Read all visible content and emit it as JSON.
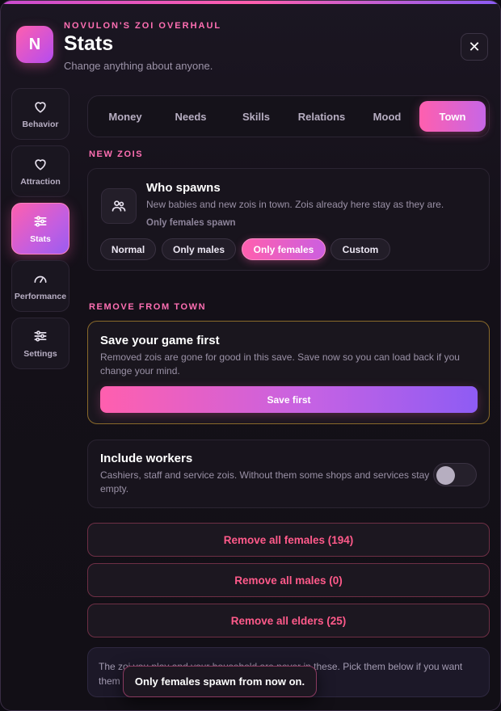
{
  "header": {
    "logo_letter": "N",
    "kicker": "NOVULON'S ZOI OVERHAUL",
    "title": "Stats",
    "subtitle": "Change anything about anyone.",
    "close_glyph": "✕"
  },
  "sidebar": {
    "items": [
      {
        "label": "Behavior",
        "icon": "heart-outline-icon",
        "active": false
      },
      {
        "label": "Attraction",
        "icon": "heart-icon",
        "active": false
      },
      {
        "label": "Stats",
        "icon": "sliders-icon",
        "active": true
      },
      {
        "label": "Performance",
        "icon": "gauge-icon",
        "active": false
      },
      {
        "label": "Settings",
        "icon": "sliders-icon",
        "active": false
      }
    ]
  },
  "tabs": [
    {
      "label": "Money",
      "active": false
    },
    {
      "label": "Needs",
      "active": false
    },
    {
      "label": "Skills",
      "active": false
    },
    {
      "label": "Relations",
      "active": false
    },
    {
      "label": "Mood",
      "active": false
    },
    {
      "label": "Town",
      "active": true
    }
  ],
  "new_zois": {
    "section_label": "NEW ZOIS",
    "title": "Who spawns",
    "description": "New babies and new zois in town. Zois already here stay as they are.",
    "status": "Only females spawn",
    "icon": "people-icon",
    "options": [
      {
        "label": "Normal",
        "active": false
      },
      {
        "label": "Only males",
        "active": false
      },
      {
        "label": "Only females",
        "active": true
      },
      {
        "label": "Custom",
        "active": false
      }
    ]
  },
  "remove_from_town": {
    "section_label": "REMOVE FROM TOWN",
    "warning": {
      "title": "Save your game first",
      "description": "Removed zois are gone for good in this save. Save now so you can load back if you change your mind.",
      "button_label": "Save first"
    },
    "include_workers": {
      "title": "Include workers",
      "description": "Cashiers, staff and service zois. Without them some shops and services stay empty.",
      "enabled": false
    },
    "actions": [
      {
        "label": "Remove all females (194)"
      },
      {
        "label": "Remove all males (0)"
      },
      {
        "label": "Remove all elders (25)"
      }
    ],
    "note": "The zoi you play and your household are never in these. Pick them below if you want them"
  },
  "toast": {
    "message": "Only females spawn from now on."
  },
  "colors": {
    "accent_pink": "#ff5fae",
    "accent_purple": "#8e5cf4",
    "danger": "#ff5a8a",
    "warning_border": "#8a6a2b"
  }
}
